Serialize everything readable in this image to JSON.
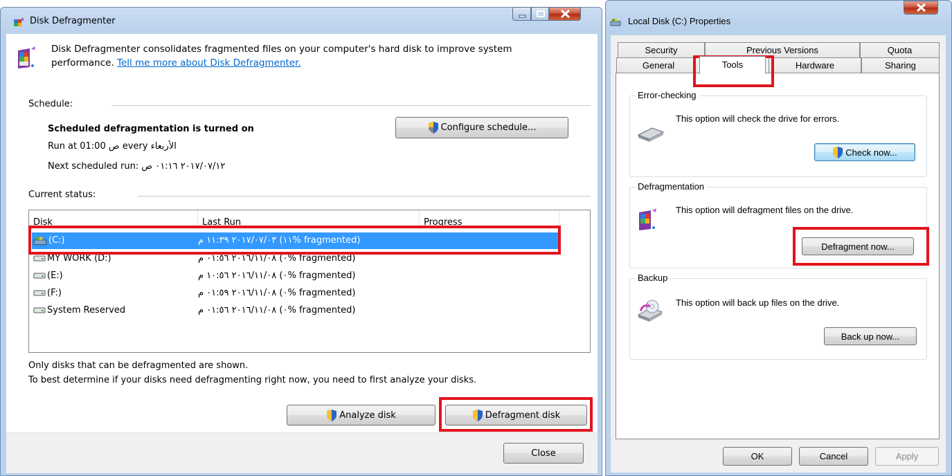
{
  "defrag": {
    "title": "Disk Defragmenter",
    "intro_text": "Disk Defragmenter consolidates fragmented files on your computer's hard disk to improve system",
    "intro_text_2": "performance.",
    "intro_link": "Tell me more about Disk Defragmenter.",
    "schedule_label": "Schedule:",
    "schedule_status": "Scheduled defragmentation is turned on",
    "run_at": "Run at 01:00 ص every الأربعاء",
    "next_run": "Next scheduled run: ٢٠١٧/٠٧/١٢ ٠١:١٦ ص",
    "configure_button": "Configure schedule...",
    "current_status_label": "Current status:",
    "columns": [
      "Disk",
      "Last Run",
      "Progress"
    ],
    "disks": [
      {
        "name": "(C:)",
        "last_run": "٢٠١٧/٠٧/٠٣ ١١:٣٩ م (١١% fragmented)",
        "progress": "",
        "selected": true
      },
      {
        "name": "MY WORK  (D:)",
        "last_run": "٢٠١٦/١١/٠٨ ٠١:٥٦ م (٠% fragmented)",
        "progress": "",
        "selected": false
      },
      {
        "name": "(E:)",
        "last_run": "٢٠١٦/١١/٠٨ ١٠:٥٦ م (٠% fragmented)",
        "progress": "",
        "selected": false
      },
      {
        "name": "(F:)",
        "last_run": "٢٠١٦/١١/٠٨ ٠١:٥٩ م (٠% fragmented)",
        "progress": "",
        "selected": false
      },
      {
        "name": "System Reserved",
        "last_run": "٢٠١٦/١١/٠٨ ٠١:٥٦ م (٠% fragmented)",
        "progress": "",
        "selected": false
      }
    ],
    "note_1": "Only disks that can be defragmented are shown.",
    "note_2": "To best determine if your disks need defragmenting right now, you need to first analyze your disks.",
    "analyze_button": "Analyze disk",
    "defragment_button": "Defragment disk",
    "close_button": "Close"
  },
  "props": {
    "title": "Local Disk (C:) Properties",
    "tabs_row1": [
      "Security",
      "Previous Versions",
      "Quota"
    ],
    "tabs_row2": [
      "General",
      "Tools",
      "Hardware",
      "Sharing"
    ],
    "active_tab": "Tools",
    "groups": {
      "error_checking": {
        "title": "Error-checking",
        "text": "This option will check the drive for errors.",
        "button": "Check now..."
      },
      "defragmentation": {
        "title": "Defragmentation",
        "text": "This option will defragment files on the drive.",
        "button": "Defragment now..."
      },
      "backup": {
        "title": "Backup",
        "text": "This option will back up files on the drive.",
        "button": "Back up now..."
      }
    },
    "ok_button": "OK",
    "cancel_button": "Cancel",
    "apply_button": "Apply"
  },
  "colors": {
    "highlight": "#e0141e",
    "selection": "#3399ff",
    "title_bar": "#c9dcf1",
    "link": "#0066cc"
  }
}
